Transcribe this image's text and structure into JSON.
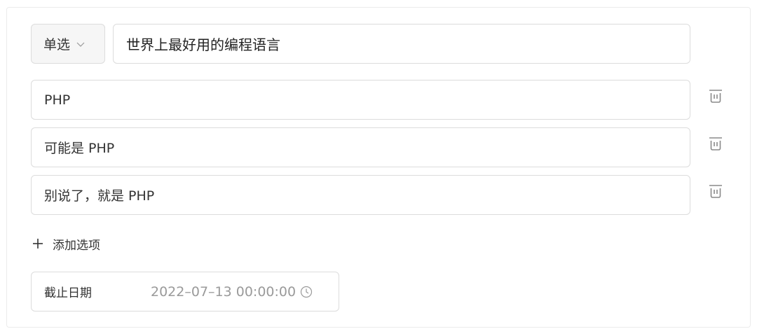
{
  "question_type": {
    "label": "单选",
    "icon": "chevron-down-icon"
  },
  "question_text": "世界上最好用的编程语言",
  "options": [
    {
      "text": "PHP"
    },
    {
      "text": "可能是 PHP"
    },
    {
      "text": "别说了，就是 PHP"
    }
  ],
  "add_option_label": "添加选项",
  "deadline": {
    "label": "截止日期",
    "value": "2022–07–13 00:00:00",
    "icon": "clock-icon"
  },
  "colors": {
    "border": "#dcdcdc",
    "select_bg": "#f6f6f6",
    "muted_text": "#9a9a9a",
    "icon": "#8a8a8a"
  }
}
